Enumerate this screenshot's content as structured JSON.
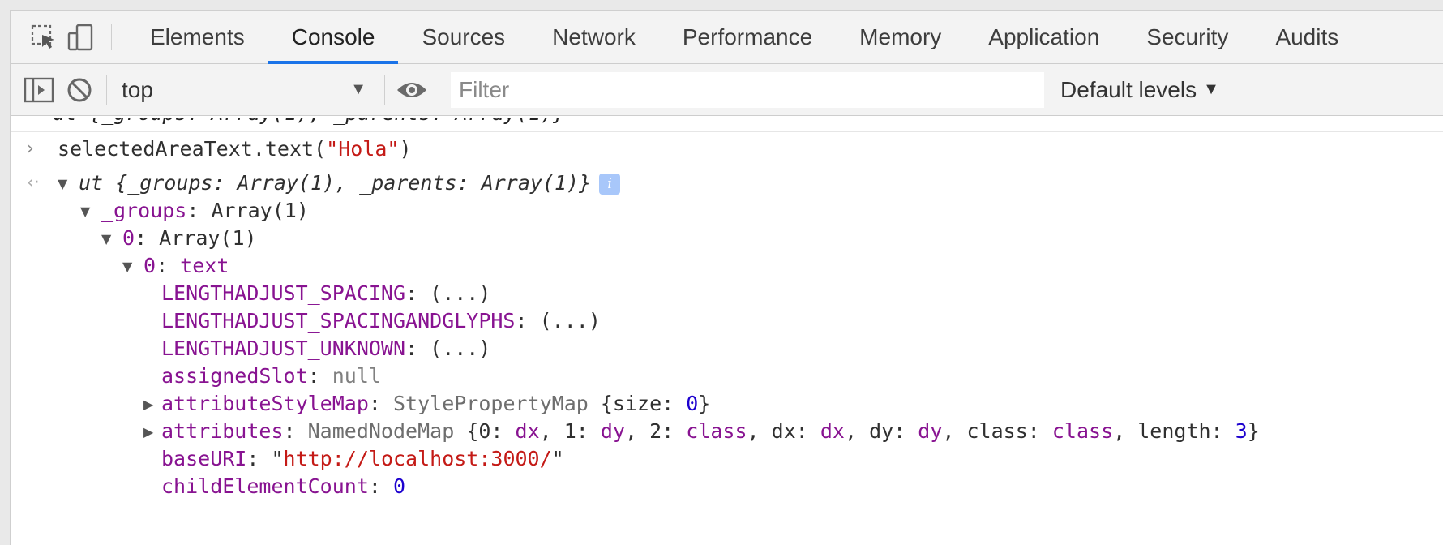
{
  "tabs": [
    {
      "label": "Elements",
      "active": false
    },
    {
      "label": "Console",
      "active": true
    },
    {
      "label": "Sources",
      "active": false
    },
    {
      "label": "Network",
      "active": false
    },
    {
      "label": "Performance",
      "active": false
    },
    {
      "label": "Memory",
      "active": false
    },
    {
      "label": "Application",
      "active": false
    },
    {
      "label": "Security",
      "active": false
    },
    {
      "label": "Audits",
      "active": false
    }
  ],
  "toolbar": {
    "context": "top",
    "filter_placeholder": "Filter",
    "filter_value": "",
    "levels_label": "Default levels"
  },
  "console": {
    "prev_line": "ut {_groups: Array(1), _parents: Array(1)}",
    "command": {
      "prefix": "selectedAreaText.text(",
      "arg": "\"Hola\"",
      "suffix": ")"
    },
    "result": {
      "summary": "ut {_groups: Array(1), _parents: Array(1)}",
      "info_badge": "i",
      "groups_key": "_groups",
      "groups_val": "Array(1)",
      "idx0_key": "0",
      "idx0_val": "Array(1)",
      "text_key": "0",
      "text_val": "text",
      "props": [
        {
          "key": "LENGTHADJUST_SPACING",
          "sep": ": ",
          "val": "(...)"
        },
        {
          "key": "LENGTHADJUST_SPACINGANDGLYPHS",
          "sep": ": ",
          "val": "(...)"
        },
        {
          "key": "LENGTHADJUST_UNKNOWN",
          "sep": ": ",
          "val": "(...)"
        },
        {
          "key": "assignedSlot",
          "sep": ": ",
          "val": "null"
        }
      ],
      "attributeStyleMap": {
        "key": "attributeStyleMap",
        "cls": "StylePropertyMap",
        "open": "{size: ",
        "num": "0",
        "close": "}"
      },
      "attributes": {
        "key": "attributes",
        "cls": "NamedNodeMap",
        "body_a": "{0: ",
        "v0": "dx",
        "body_b": ", 1: ",
        "v1": "dy",
        "body_c": ", 2: ",
        "v2": "class",
        "body_d": ", dx: ",
        "v3": "dx",
        "body_e": ", dy: ",
        "v4": "dy",
        "body_f": ", class: ",
        "v5": "class",
        "body_g": ", length: ",
        "len": "3",
        "body_h": "}"
      },
      "baseURI": {
        "key": "baseURI",
        "q1": "\"",
        "url": "http://localhost:3000/",
        "q2": "\""
      },
      "childElementCount": {
        "key": "childElementCount",
        "val": "0"
      }
    }
  }
}
